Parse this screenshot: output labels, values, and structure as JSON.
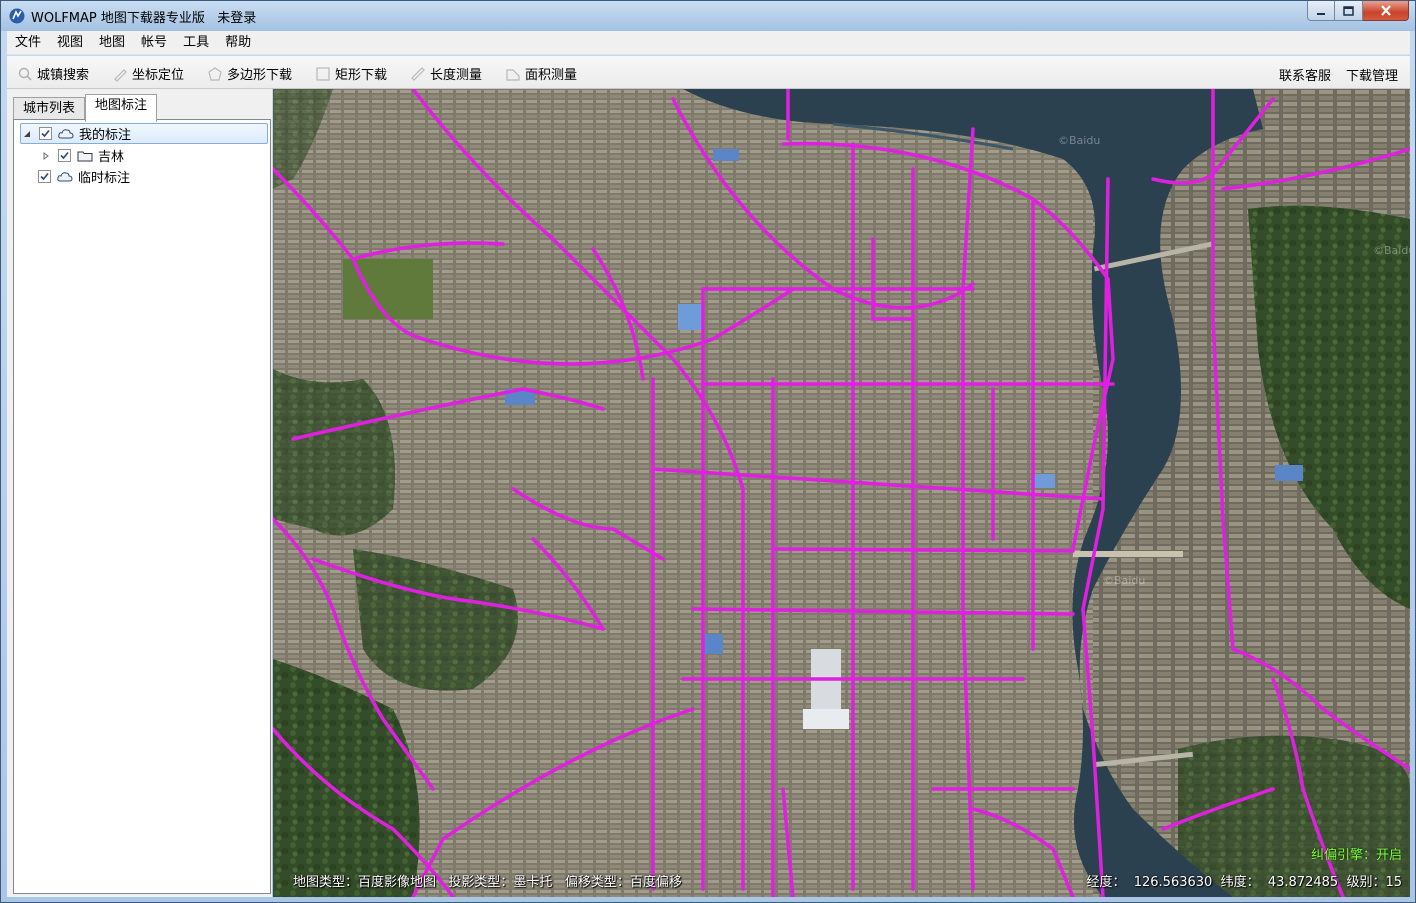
{
  "window": {
    "title": "WOLFMAP 地图下载器专业版",
    "login_status": "未登录"
  },
  "menu": {
    "items": [
      "文件",
      "视图",
      "地图",
      "帐号",
      "工具",
      "帮助"
    ]
  },
  "toolbar": {
    "tools": [
      "城镇搜索",
      "坐标定位",
      "多边形下载",
      "矩形下载",
      "长度测量",
      "面积测量"
    ],
    "right_links": [
      "联系客服",
      "下载管理"
    ]
  },
  "sidebar": {
    "tabs": [
      "城市列表",
      "地图标注"
    ],
    "active_tab": "地图标注",
    "tree": [
      {
        "label": "我的标注",
        "checked": true,
        "expanded": true,
        "selected": true
      },
      {
        "label": "吉林",
        "checked": true,
        "expanded": false,
        "selected": false
      },
      {
        "label": "临时标注",
        "checked": true,
        "expanded": false,
        "selected": false
      }
    ]
  },
  "map": {
    "watermark": "©Baidu",
    "status": {
      "map_type": "地图类型：百度影像地图",
      "projection": "投影类型：墨卡托",
      "offset": "偏移类型：百度偏移",
      "longitude_label": "经度：",
      "longitude": "126.563630",
      "latitude_label": "纬度：",
      "latitude": "43.872485",
      "level_label": "级别：",
      "level": "15"
    },
    "engine_status": "纠偏引擎：开启",
    "colors": {
      "road": "#e020e0",
      "river": "#2a4250",
      "urban": "#8a8372",
      "vegetation": "#3f5a32"
    }
  }
}
